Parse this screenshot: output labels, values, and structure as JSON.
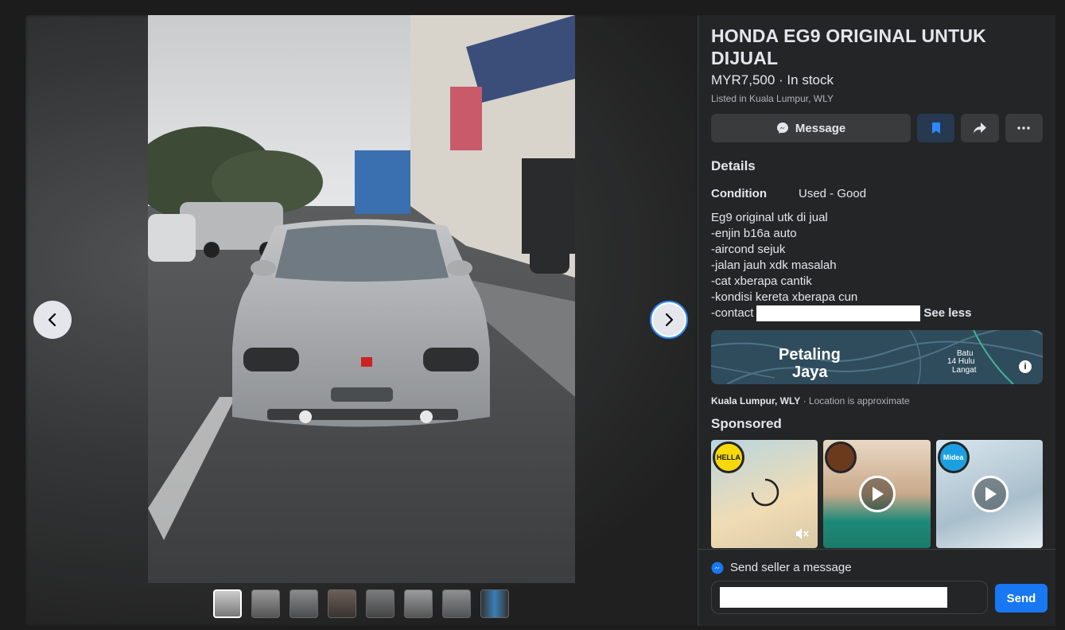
{
  "listing": {
    "title": "HONDA EG9 ORIGINAL UNTUK DIJUAL",
    "price_line": "MYR7,500 · In stock",
    "listed_in": "Listed in Kuala Lumpur, WLY"
  },
  "actions": {
    "message_label": "Message",
    "message_icon": "messenger-icon",
    "save_icon": "bookmark-icon",
    "share_icon": "share-icon",
    "more_icon": "more-icon"
  },
  "details": {
    "heading": "Details",
    "condition_label": "Condition",
    "condition_value": "Used - Good",
    "description_lines": [
      "Eg9 original utk di jual",
      "-enjin b16a auto",
      "-aircond sejuk",
      "-jalan jauh xdk masalah",
      "-cat xberapa cantik",
      "-kondisi kereta xberapa cun"
    ],
    "contact_prefix": "-contact",
    "see_less": "See less"
  },
  "map": {
    "label_main_1": "Petaling",
    "label_main_2": "Jaya",
    "label_side_1": "Batu",
    "label_side_2": "14 Hulu",
    "label_side_3": "Langat",
    "info_glyph": "i"
  },
  "location": {
    "place": "Kuala Lumpur, WLY",
    "note": " · Location is approximate"
  },
  "sponsored": {
    "heading": "Sponsored",
    "ads": [
      {
        "logo_text": "HELLA",
        "logo_color": "#f5d90a"
      },
      {
        "logo_text": "",
        "logo_color": "#6b3a1d"
      },
      {
        "logo_text": "Midea",
        "logo_color": "#1aa0e0"
      }
    ]
  },
  "send": {
    "label": "Send seller a message",
    "input_value": "",
    "button": "Send"
  },
  "colors": {
    "accent": "#1877f2",
    "panel_bg": "#242526",
    "button_bg": "#3a3b3c"
  }
}
